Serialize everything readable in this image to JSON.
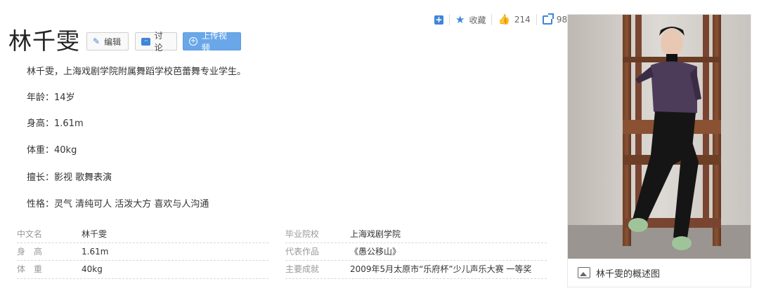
{
  "header": {
    "title": "林千雯",
    "edit_label": "编辑",
    "discuss_label": "讨论",
    "upload_label": "上传视频"
  },
  "stats": {
    "collect_label": "收藏",
    "likes": "214",
    "shares": "98"
  },
  "intro": [
    "林千雯，上海戏剧学院附属舞蹈学校芭蕾舞专业学生。",
    "年龄：14岁",
    "身高：1.61m",
    "体重：40kg",
    "擅长：影视 歌舞表演",
    "性格：灵气 清纯可人 活泼大方 喜欢与人沟通"
  ],
  "basic_info": {
    "left": [
      {
        "label": "中文名",
        "value": "林千雯"
      },
      {
        "label": "身　高",
        "value": "1.61m"
      },
      {
        "label": "体　重",
        "value": "40kg"
      }
    ],
    "right": [
      {
        "label": "毕业院校",
        "value": "上海戏剧学院"
      },
      {
        "label": "代表作品",
        "value": "《愚公移山》"
      },
      {
        "label": "主要成就",
        "value": "2009年5月太原市“乐府杯”少儿声乐大赛 一等奖"
      }
    ]
  },
  "summary_image": {
    "caption": "林千雯的概述图"
  },
  "colors": {
    "accent": "#3d86d8",
    "upload_button": "#6aa7e8"
  }
}
